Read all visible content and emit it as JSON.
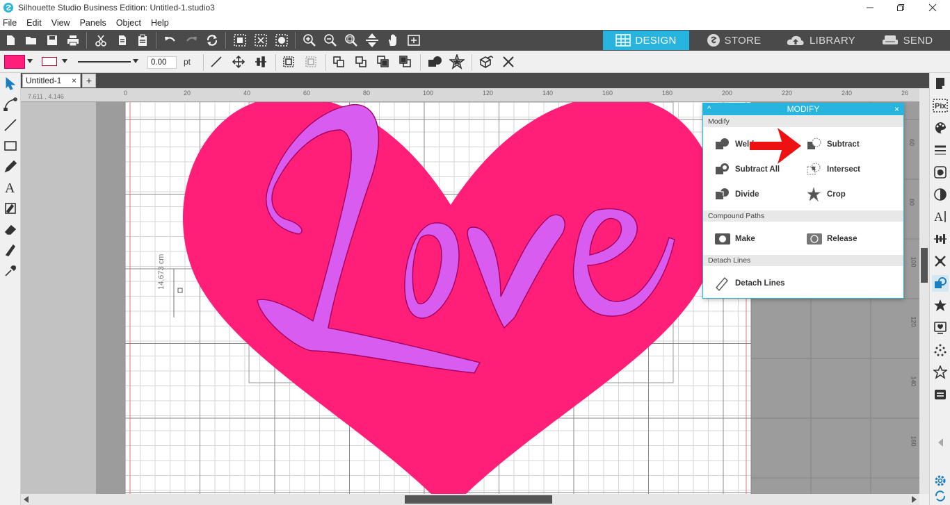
{
  "window": {
    "title": "Silhouette Studio Business Edition: Untitled-1.studio3"
  },
  "menu": [
    "File",
    "Edit",
    "View",
    "Panels",
    "Object",
    "Help"
  ],
  "nav_tabs": [
    {
      "label": "DESIGN",
      "active": true
    },
    {
      "label": "STORE",
      "active": false
    },
    {
      "label": "LIBRARY",
      "active": false
    },
    {
      "label": "SEND",
      "active": false
    }
  ],
  "toolbar2": {
    "fill_color": "#ff1f7a",
    "line_width_value": "0.00",
    "line_width_unit": "pt"
  },
  "document_tab": {
    "name": "Untitled-1",
    "close": "×",
    "add": "+"
  },
  "ruler": {
    "coord_readout": "7.611 , 4.146",
    "ticks": [
      "0",
      "20",
      "40",
      "60",
      "80",
      "100",
      "120",
      "140",
      "160",
      "180",
      "200",
      "220",
      "240",
      "26"
    ],
    "v_ticks": [
      "60",
      "80",
      "100",
      "120",
      "140",
      "160"
    ]
  },
  "canvas": {
    "dimension_label": "14.673 cm",
    "heart_color": "#ff1f78",
    "text_color": "#d95cf0",
    "text": "love"
  },
  "modify_panel": {
    "title": "MODIFY",
    "collapse": "^",
    "close": "×",
    "sections": [
      {
        "label": "Modify",
        "items": [
          "Weld",
          "Subtract",
          "Subtract All",
          "Intersect",
          "Divide",
          "Crop"
        ]
      },
      {
        "label": "Compound Paths",
        "items": [
          "Make",
          "Release"
        ]
      },
      {
        "label": "Detach Lines",
        "items": [
          "Detach Lines"
        ]
      }
    ]
  },
  "right_panel_icons": [
    "page-setup-icon",
    "pixscan-icon",
    "fill-icon",
    "line-style-icon",
    "trace-icon",
    "shadow-icon",
    "text-style-icon",
    "align-icon",
    "replicate-icon",
    "modify-icon",
    "offset-icon",
    "library-icon",
    "points-icon",
    "star-icon",
    "layers-icon"
  ]
}
